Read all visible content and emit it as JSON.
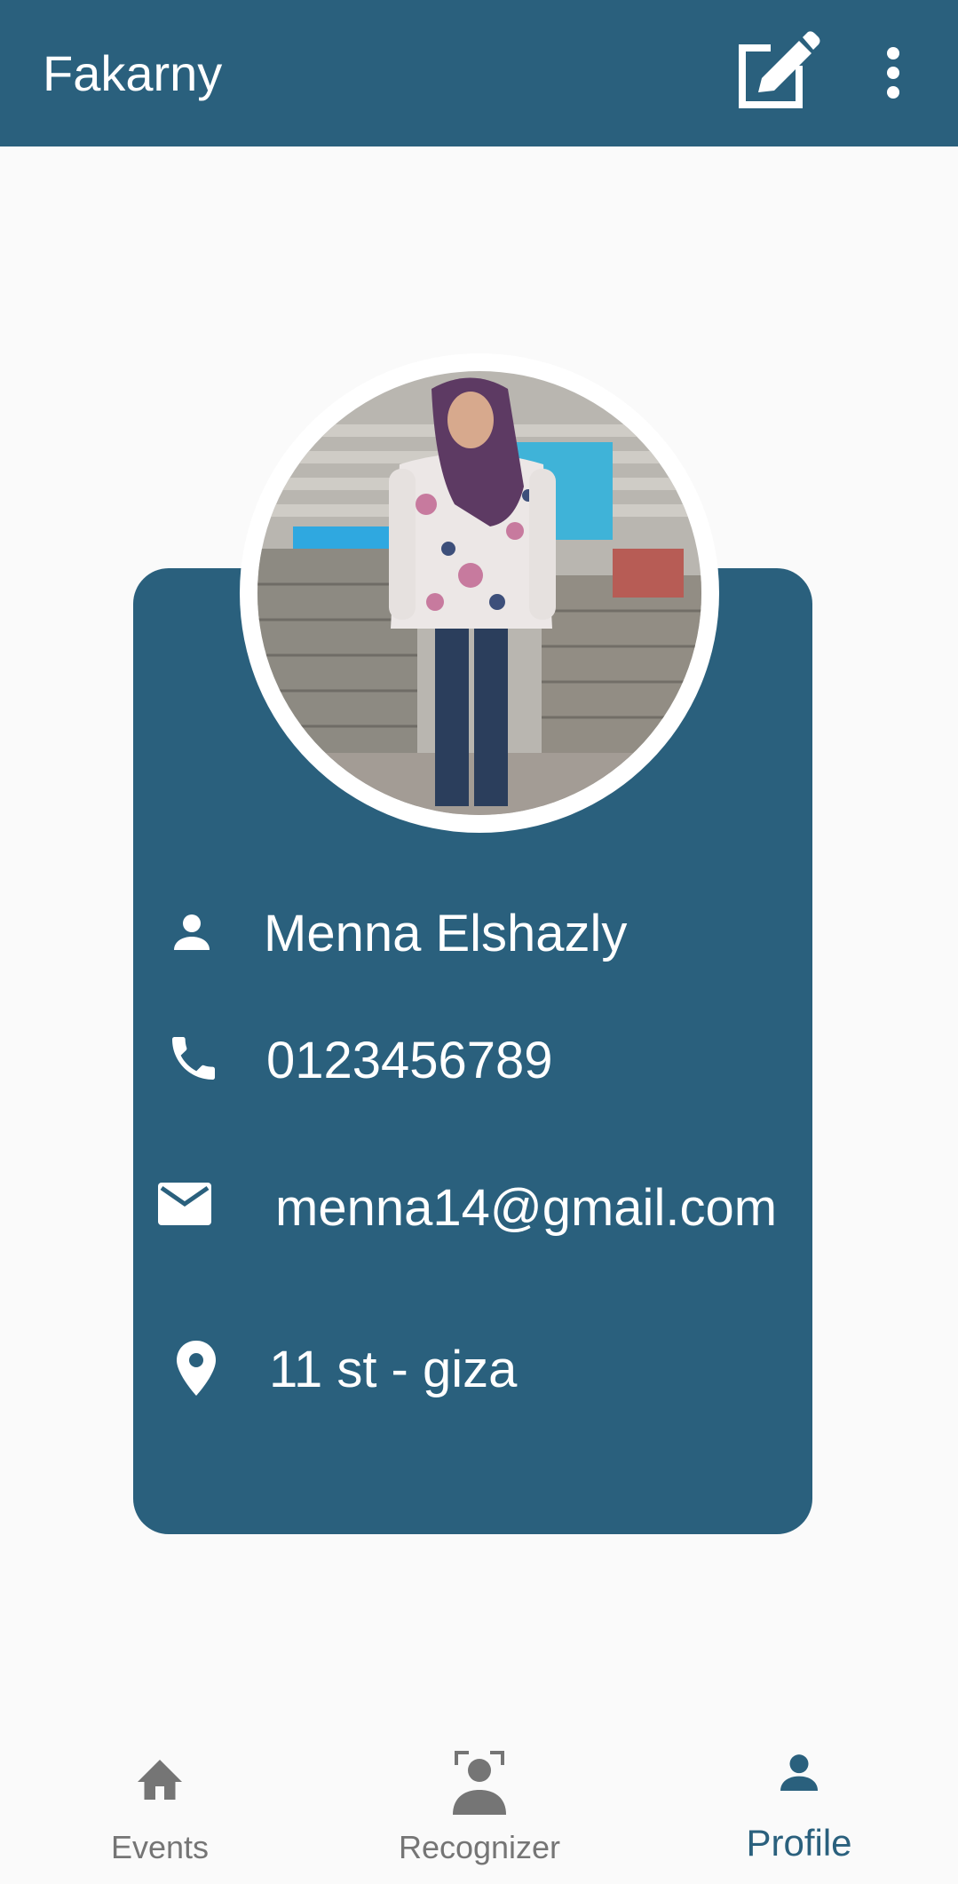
{
  "app_bar": {
    "title": "Fakarny",
    "edit_icon": "edit-note-icon",
    "more_icon": "more-vert-icon"
  },
  "profile": {
    "avatar_alt": "profile photo",
    "name": "Menna Elshazly",
    "phone": "0123456789",
    "email": "menna14@gmail.com",
    "address": "11 st - giza"
  },
  "bottom_nav": {
    "items": [
      {
        "label": "Events",
        "icon": "home-icon",
        "active": false
      },
      {
        "label": "Recognizer",
        "icon": "face-scan-icon",
        "active": false
      },
      {
        "label": "Profile",
        "icon": "person-icon",
        "active": true
      }
    ]
  },
  "colors": {
    "primary": "#2a607d",
    "background": "#fafafa",
    "inactive": "#757575",
    "on_primary": "#ffffff"
  }
}
